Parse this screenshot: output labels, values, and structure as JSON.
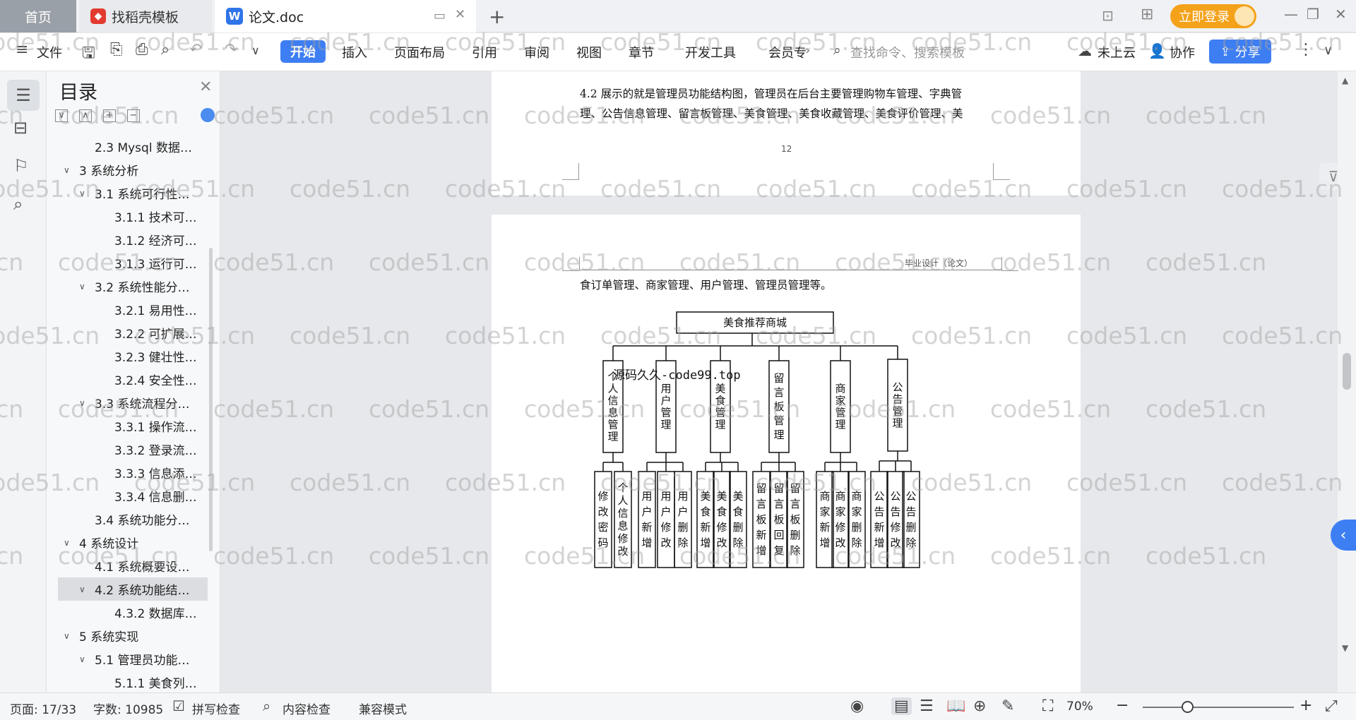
{
  "tabs": {
    "home": "首页",
    "template": "找稻壳模板",
    "doc": "论文.doc",
    "new_tab": "+",
    "login": "立即登录"
  },
  "toolbar": {
    "file": "文件",
    "start": "开始",
    "insert": "插入",
    "layout": "页面布局",
    "reference": "引用",
    "review": "审阅",
    "view": "视图",
    "chapter": "章节",
    "devtools": "开发工具",
    "member": "会员专",
    "search_placeholder": "查找命令、搜索模板",
    "cloud": "未上云",
    "collab": "协作",
    "share": "分享"
  },
  "toc": {
    "title": "目录",
    "items": [
      {
        "label": "2.3 Mysql 数据…",
        "level": 2,
        "chev": ""
      },
      {
        "label": "3  系统分析",
        "level": 1,
        "chev": "∨"
      },
      {
        "label": "3.1  系统可行性…",
        "level": 2,
        "chev": "∨"
      },
      {
        "label": "3.1.1  技术可…",
        "level": 3,
        "chev": ""
      },
      {
        "label": "3.1.2  经济可…",
        "level": 3,
        "chev": ""
      },
      {
        "label": "3.1.3  运行可…",
        "level": 3,
        "chev": ""
      },
      {
        "label": "3.2  系统性能分…",
        "level": 2,
        "chev": "∨"
      },
      {
        "label": "3.2.1  易用性…",
        "level": 3,
        "chev": ""
      },
      {
        "label": "3.2.2  可扩展…",
        "level": 3,
        "chev": ""
      },
      {
        "label": "3.2.3  健壮性…",
        "level": 3,
        "chev": ""
      },
      {
        "label": "3.2.4  安全性…",
        "level": 3,
        "chev": ""
      },
      {
        "label": "3.3  系统流程分…",
        "level": 2,
        "chev": "∨"
      },
      {
        "label": "3.3.1  操作流…",
        "level": 3,
        "chev": ""
      },
      {
        "label": "3.3.2  登录流…",
        "level": 3,
        "chev": ""
      },
      {
        "label": "3.3.3  信息添…",
        "level": 3,
        "chev": ""
      },
      {
        "label": "3.3.4  信息删…",
        "level": 3,
        "chev": ""
      },
      {
        "label": "3.4  系统功能分…",
        "level": 2,
        "chev": ""
      },
      {
        "label": "4  系统设计",
        "level": 1,
        "chev": "∨"
      },
      {
        "label": "4.1  系统概要设…",
        "level": 2,
        "chev": ""
      },
      {
        "label": "4.2  系统功能结…",
        "level": 2,
        "chev": "∨",
        "active": true
      },
      {
        "label": "4.3.2  数据库…",
        "level": 3,
        "chev": ""
      },
      {
        "label": "5  系统实现",
        "level": 1,
        "chev": "∨"
      },
      {
        "label": "5.1  管理员功能…",
        "level": 2,
        "chev": "∨"
      },
      {
        "label": "5.1.1  美食列…",
        "level": 3,
        "chev": ""
      }
    ]
  },
  "doc": {
    "top_line1": "4.2 展示的就是管理员功能结构图，管理员在后台主要管理购物车管理、字典管",
    "top_line2": "理、公告信息管理、留言板管理、美食管理、美食收藏管理、美食评价管理、美",
    "page_number": "12",
    "header_right": "毕业设计（论文）",
    "body_line": "食订单管理、商家管理、用户管理、管理员管理等。",
    "source_mark": "源码久久-code99.top"
  },
  "diagram": {
    "root": "美食推荐商城",
    "groups": [
      {
        "name": "个人信息管理",
        "children": [
          "修改密码",
          "个人信息修改"
        ]
      },
      {
        "name": "用户管理",
        "children": [
          "用户新增",
          "用户修改",
          "用户删除"
        ]
      },
      {
        "name": "美食管理",
        "children": [
          "美食新增",
          "美食修改",
          "美食删除"
        ]
      },
      {
        "name": "留言板管理",
        "children": [
          "留言板新增",
          "留言板回复",
          "留言板删除"
        ]
      },
      {
        "name": "商家管理",
        "children": [
          "商家新增",
          "商家修改",
          "商家删除"
        ]
      },
      {
        "name": "公告管理",
        "children": [
          "公告新增",
          "公告修改",
          "公告删除"
        ]
      }
    ]
  },
  "watermark": "code51.cn",
  "status": {
    "page": "页面: 17/33",
    "words": "字数: 10985",
    "spell": "拼写检查",
    "content": "内容检查",
    "compat": "兼容模式",
    "zoom": "70%"
  }
}
